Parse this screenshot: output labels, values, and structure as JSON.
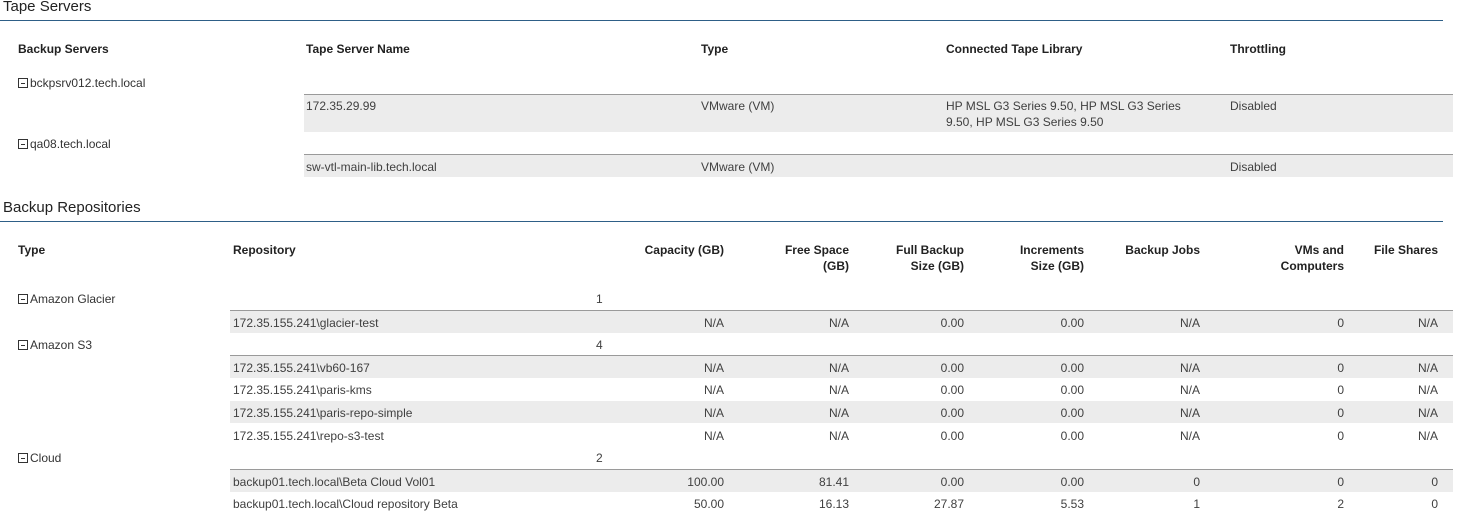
{
  "tape_servers": {
    "title": "Tape Servers",
    "columns": [
      "Backup Servers",
      "Tape Server Name",
      "Type",
      "Connected Tape Library",
      "Throttling"
    ],
    "groups": [
      {
        "name": "bckpsrv012.tech.local",
        "rows": [
          {
            "name": "172.35.29.99",
            "type": "VMware (VM)",
            "library_line1": "HP MSL G3 Series 9.50, HP MSL G3 Series",
            "library_line2": "9.50, HP MSL G3 Series 9.50",
            "throttling": "Disabled"
          }
        ]
      },
      {
        "name": "qa08.tech.local",
        "rows": [
          {
            "name": "sw-vtl-main-lib.tech.local",
            "type": "VMware (VM)",
            "library_line1": "",
            "library_line2": "",
            "throttling": "Disabled"
          }
        ]
      }
    ]
  },
  "repositories": {
    "title": "Backup Repositories",
    "columns": {
      "type": "Type",
      "repository": "Repository",
      "capacity": "Capacity (GB)",
      "free_space_1": "Free Space",
      "free_space_2": "(GB)",
      "full_backup_1": "Full Backup",
      "full_backup_2": "Size (GB)",
      "increments_1": "Increments",
      "increments_2": "Size (GB)",
      "backup_jobs": "Backup Jobs",
      "vms_1": "VMs and",
      "vms_2": "Computers",
      "file_shares": "File Shares"
    },
    "groups": [
      {
        "name": "Amazon Glacier",
        "count": "1",
        "rows": [
          [
            "172.35.155.241\\glacier-test",
            "N/A",
            "N/A",
            "0.00",
            "0.00",
            "N/A",
            "0",
            "N/A"
          ]
        ]
      },
      {
        "name": "Amazon S3",
        "count": "4",
        "rows": [
          [
            "172.35.155.241\\vb60-167",
            "N/A",
            "N/A",
            "0.00",
            "0.00",
            "N/A",
            "0",
            "N/A"
          ],
          [
            "172.35.155.241\\paris-kms",
            "N/A",
            "N/A",
            "0.00",
            "0.00",
            "N/A",
            "0",
            "N/A"
          ],
          [
            "172.35.155.241\\paris-repo-simple",
            "N/A",
            "N/A",
            "0.00",
            "0.00",
            "N/A",
            "0",
            "N/A"
          ],
          [
            "172.35.155.241\\repo-s3-test",
            "N/A",
            "N/A",
            "0.00",
            "0.00",
            "N/A",
            "0",
            "N/A"
          ]
        ]
      },
      {
        "name": "Cloud",
        "count": "2",
        "rows": [
          [
            "backup01.tech.local\\Beta Cloud Vol01",
            "100.00",
            "81.41",
            "0.00",
            "0.00",
            "0",
            "0",
            "0"
          ],
          [
            "backup01.tech.local\\Cloud repository Beta",
            "50.00",
            "16.13",
            "27.87",
            "5.53",
            "1",
            "2",
            "0"
          ]
        ]
      }
    ]
  }
}
